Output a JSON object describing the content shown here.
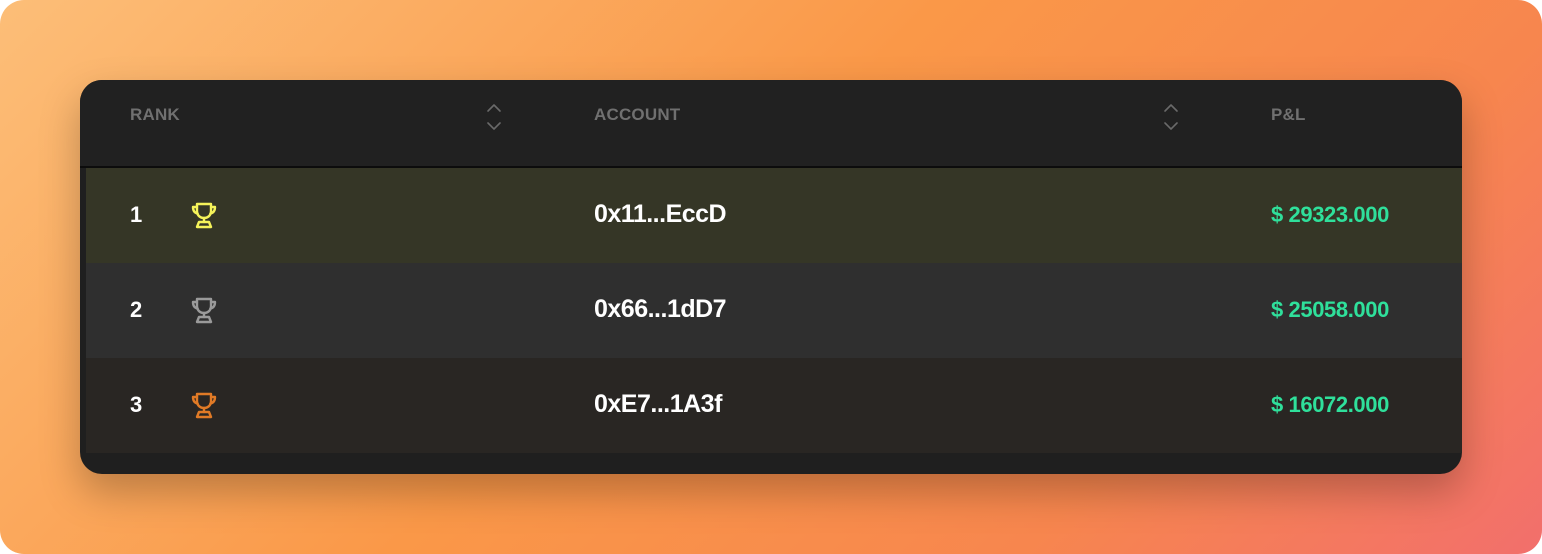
{
  "table": {
    "columns": [
      {
        "label": "RANK",
        "sortable": true
      },
      {
        "label": "ACCOUNT",
        "sortable": true
      },
      {
        "label": "P&L",
        "sortable": false
      }
    ],
    "rows": [
      {
        "rank": "1",
        "trophy": "gold-trophy-icon",
        "account": "0x11...EccD",
        "pnl": "$ 29323.000"
      },
      {
        "rank": "2",
        "trophy": "silver-trophy-icon",
        "account": "0x66...1dD7",
        "pnl": "$ 25058.000"
      },
      {
        "rank": "3",
        "trophy": "bronze-trophy-icon",
        "account": "0xE7...1A3f",
        "pnl": "$ 16072.000"
      }
    ]
  },
  "colors": {
    "gold": "#f5f35a",
    "silver": "#9a9a9a",
    "bronze": "#e07a26",
    "pnl_positive": "#2fe09b",
    "row1_bg": "#353626",
    "row2_bg": "#2f2f2f",
    "row3_bg": "#292623"
  }
}
